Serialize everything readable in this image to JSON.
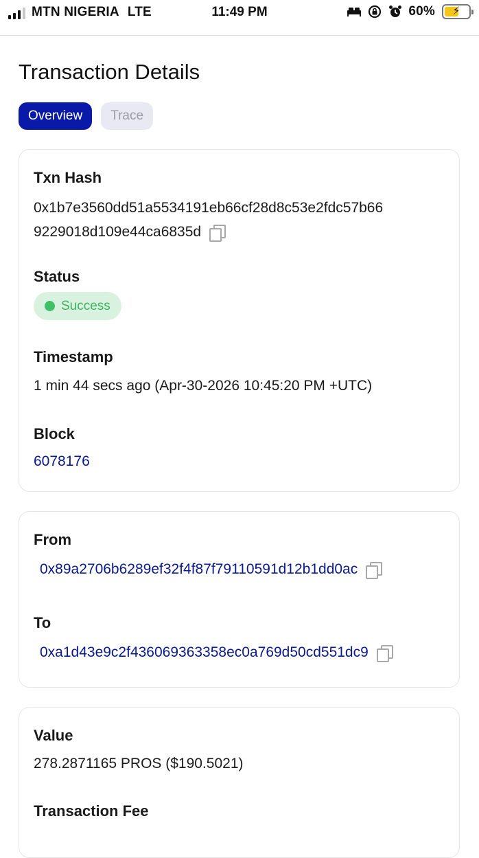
{
  "status_bar": {
    "carrier": "MTN NIGERIA",
    "network": "LTE",
    "time": "11:49 PM",
    "battery_percent": "60%",
    "battery_level": 0.6,
    "icons": [
      "signal-icon",
      "bed-icon",
      "orientation-lock-icon",
      "alarm-icon",
      "battery-charging-icon"
    ]
  },
  "page": {
    "title": "Transaction Details",
    "tabs": [
      {
        "label": "Overview",
        "active": true
      },
      {
        "label": "Trace",
        "active": false
      }
    ]
  },
  "overview_card": {
    "txn_hash_label": "Txn Hash",
    "txn_hash_line1": "0x1b7e3560dd51a5534191eb66cf28d8c53e2fdc57b66",
    "txn_hash_line2": "9229018d109e44ca6835d",
    "status_label": "Status",
    "status_value": "Success",
    "timestamp_label": "Timestamp",
    "timestamp_value": "1 min 44 secs ago (Apr-30-2026 10:45:20 PM +UTC)",
    "block_label": "Block",
    "block_value": "6078176"
  },
  "address_card": {
    "from_label": "From",
    "from_value": "0x89a2706b6289ef32f4f87f79110591d12b1dd0ac",
    "to_label": "To",
    "to_value": "0xa1d43e9c2f436069363358ec0a769d50cd551dc9"
  },
  "value_card": {
    "value_label": "Value",
    "value_value": "278.2871165 PROS ($190.5021)",
    "fee_label": "Transaction Fee"
  },
  "colors": {
    "accent": "#0a1aa8",
    "link": "#0a1a8c",
    "success_bg": "#d9f2e0",
    "success_text": "#3db35e"
  }
}
